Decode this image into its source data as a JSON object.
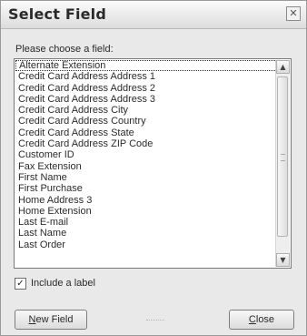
{
  "window": {
    "title": "Select Field",
    "close_glyph": "✕"
  },
  "prompt": "Please choose a field:",
  "list": {
    "selected_index": 0,
    "items": [
      "Alternate Extension",
      "Credit Card Address Address 1",
      "Credit Card Address Address 2",
      "Credit Card Address Address 3",
      "Credit Card Address City",
      "Credit Card Address Country",
      "Credit Card Address State",
      "Credit Card Address ZIP Code",
      "Customer ID",
      "Fax Extension",
      "First Name",
      "First Purchase",
      "Home Address 3",
      "Home Extension",
      "Last E-mail",
      "Last Name",
      "Last Order"
    ],
    "scroll_up_glyph": "▲",
    "scroll_down_glyph": "▼"
  },
  "include_label": {
    "label": "Include a label",
    "checked": true,
    "check_glyph": "✓"
  },
  "buttons": {
    "new_field": {
      "mnemonic": "N",
      "rest": "ew Field"
    },
    "close": {
      "mnemonic": "C",
      "rest": "lose"
    }
  }
}
